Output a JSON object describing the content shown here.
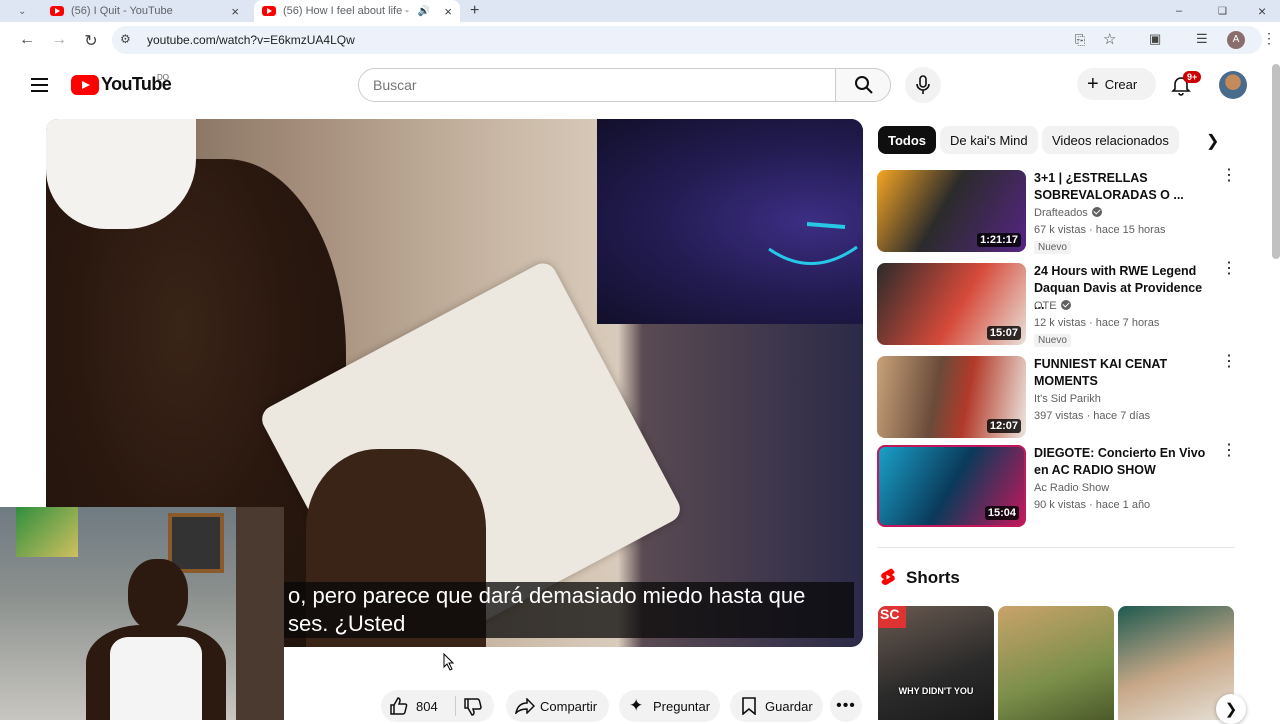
{
  "browser": {
    "tabs": [
      {
        "title": "(56) I Quit - YouTube"
      },
      {
        "title": "(56) How I feel about life -"
      }
    ],
    "url": "youtube.com/watch?v=E6kmzUA4LQw",
    "profile_initial": "A"
  },
  "header": {
    "logo_text": "YouTube",
    "country": "DO",
    "search_placeholder": "Buscar",
    "create_label": "Crear",
    "notifications_badge": "9+"
  },
  "player": {
    "caption_line1": "o, pero parece que dará demasiado miedo hasta que",
    "caption_line2": "ses. ¿Usted"
  },
  "actions": {
    "likes": "804",
    "share_label": "Compartir",
    "ask_label": "Preguntar",
    "save_label": "Guardar"
  },
  "chips": [
    "Todos",
    "De kai's Mind",
    "Videos relacionados"
  ],
  "recommendations": [
    {
      "title": "3+1 | ¿ESTRELLAS SOBREVALORADAS O ...",
      "channel": "Drafteados",
      "verified": true,
      "meta": "67 k vistas · hace 15 horas",
      "badge": "Nuevo",
      "duration": "1:21:17",
      "colors": [
        "#f6a623",
        "#552583"
      ]
    },
    {
      "title": "24 Hours with RWE Legend Daquan Davis at Providence ...",
      "channel": "OTE",
      "verified": true,
      "meta": "12 k vistas · hace 7 horas",
      "badge": "Nuevo",
      "duration": "15:07",
      "colors": [
        "#d64a3a",
        "#2b2b2b"
      ]
    },
    {
      "title": "FUNNIEST KAI CENAT MOMENTS",
      "channel": "It's Sid Parikh",
      "verified": false,
      "meta": "397 vistas · hace 7 días",
      "badge": "",
      "duration": "12:07",
      "colors": [
        "#c9a27a",
        "#b23a2a"
      ]
    },
    {
      "title": "DIEGOTE: Concierto En Vivo en AC RADIO SHOW",
      "channel": "Ac Radio Show",
      "verified": false,
      "meta": "90 k vistas · hace 1 año",
      "badge": "",
      "duration": "15:04",
      "colors": [
        "#1aa0c8",
        "#c2185b"
      ]
    }
  ],
  "shorts": {
    "title": "Shorts",
    "items": [
      {
        "overlay": "WHY DIDN'T YOU",
        "colors": [
          "#6a5a50",
          "#1a1a1a"
        ]
      },
      {
        "overlay": "",
        "colors": [
          "#7b8f4a",
          "#c9a36a"
        ]
      },
      {
        "overlay": "",
        "colors": [
          "#1f5a50",
          "#e6e1d8"
        ]
      }
    ]
  },
  "colors": {
    "brand_red": "#ff0000",
    "chip_active_bg": "#0f0f0f"
  }
}
